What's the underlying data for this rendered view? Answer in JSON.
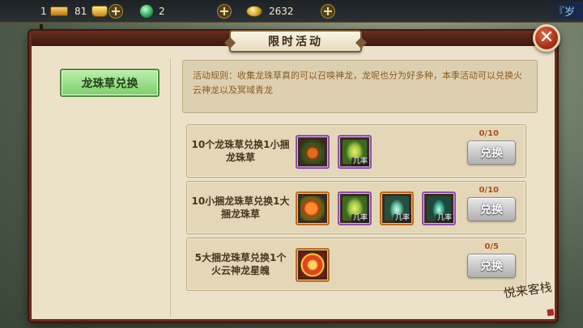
{
  "topbar": {
    "gold_bars": "1",
    "ingots": "81",
    "jade": "2",
    "coins": "2632",
    "corner_tag": "『岁"
  },
  "dialog": {
    "title": "限时活动",
    "close_symbol": "✕"
  },
  "sidebar": {
    "tabs": [
      {
        "label": "龙珠草兑换"
      }
    ]
  },
  "rules": {
    "text": "活动规则：收集龙珠草真的可以召唤神龙，龙呢也分为好多种，本季活动可以兑换火云神龙以及冥域青龙"
  },
  "exchanges": [
    {
      "description": "10个龙珠草兑换1小捆龙珠草",
      "count": "0/10",
      "button": "兑换",
      "items": [
        {
          "icon": "dragon-grass-bundle",
          "rate_label": ""
        },
        {
          "icon": "green-egg",
          "rate_label": "几率"
        }
      ]
    },
    {
      "description": "10小捆龙珠草兑换1大捆龙珠草",
      "count": "0/10",
      "button": "兑换",
      "items": [
        {
          "icon": "dragon-grass-big-bundle",
          "rate_label": ""
        },
        {
          "icon": "green-egg",
          "rate_label": "几率"
        },
        {
          "icon": "jade-vase",
          "rate_label": "几率"
        },
        {
          "icon": "teal-vase",
          "rate_label": "几率"
        }
      ]
    },
    {
      "description": "5大捆龙珠草兑换1个火云神龙星魄",
      "count": "0/5",
      "button": "兑换",
      "items": [
        {
          "icon": "fire-dragon-star-soul",
          "rate_label": ""
        }
      ]
    }
  ],
  "watermark": {
    "text": "悦来客栈"
  },
  "colors": {
    "panel_bg": "#ece2c9",
    "frame": "#6a2a1a",
    "tab_active": "#7fcf6e",
    "rule_text": "#8a5a20",
    "count_text": "#a8521c",
    "button_disabled": "#b0b0b0",
    "item_border_purple": "#8e4fb0",
    "item_border_orange": "#c46a1a"
  }
}
